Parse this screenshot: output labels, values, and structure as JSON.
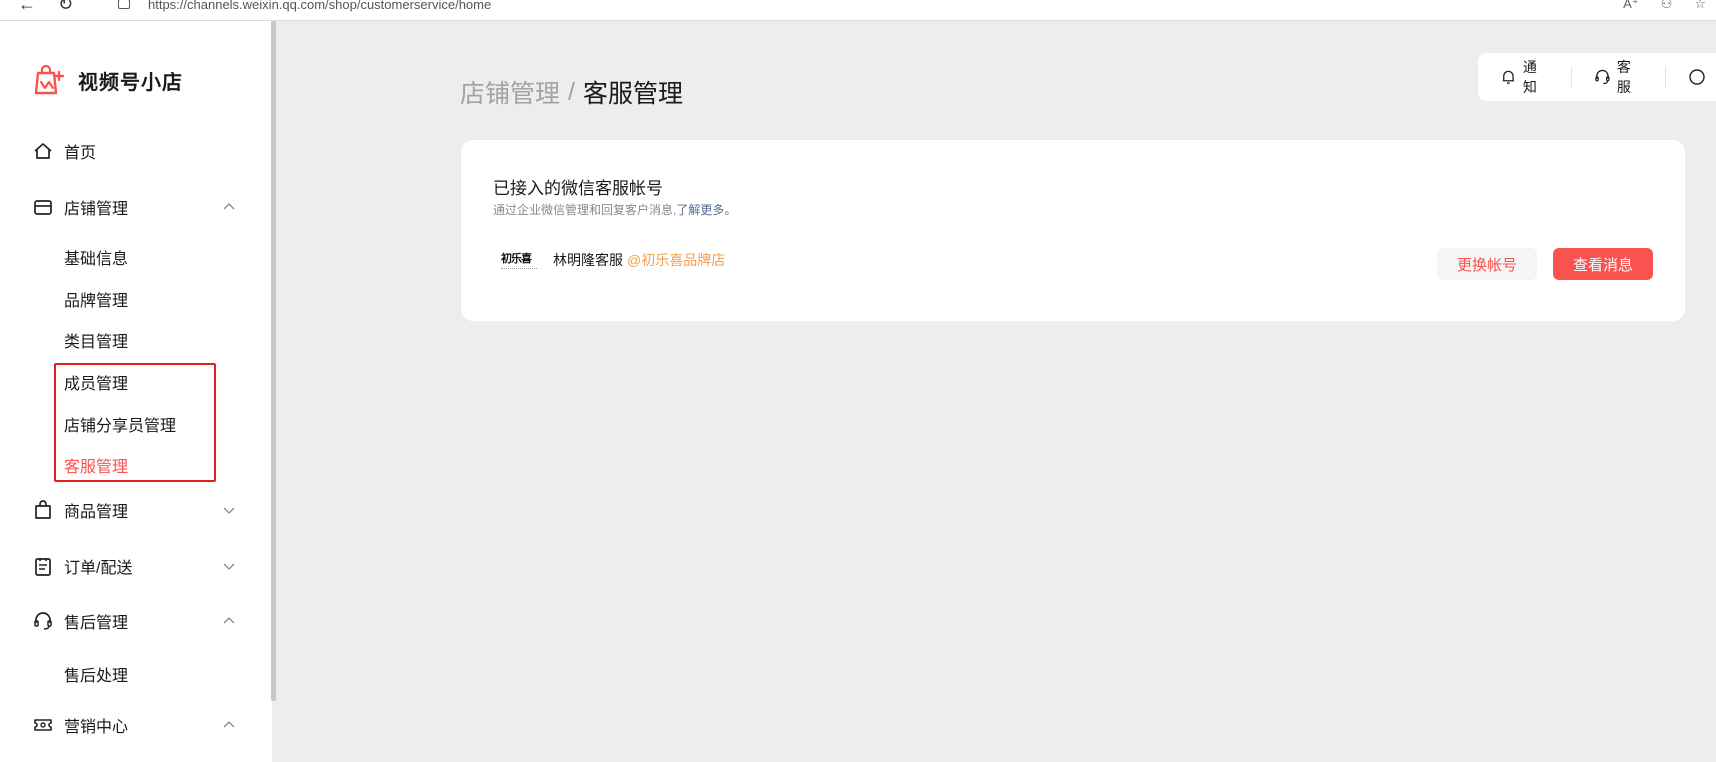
{
  "browser": {
    "url": "https://channels.weixin.qq.com/shop/customerservice/home",
    "back_icon": "arrow-left-icon",
    "reload_icon": "reload-icon"
  },
  "app": {
    "name": "视频号小店",
    "accent_color": "#fa5151"
  },
  "sidebar": {
    "home": "首页",
    "store": {
      "label": "店铺管理",
      "children": [
        "基础信息",
        "品牌管理",
        "类目管理",
        "成员管理",
        "店铺分享员管理",
        "客服管理"
      ]
    },
    "products": "商品管理",
    "orders": "订单/配送",
    "aftersales": {
      "label": "售后管理",
      "children": [
        "售后处理"
      ]
    },
    "marketing": "营销中心"
  },
  "top_actions": {
    "notify": "通知",
    "service": "客服"
  },
  "breadcrumb": {
    "parent": "店铺管理",
    "separator": "/",
    "current": "客服管理"
  },
  "card": {
    "title": "已接入的微信客服帐号",
    "description": "通过企业微信管理和回复客户消息,",
    "learn_more": "了解更多。",
    "account": {
      "logo_text": "初乐喜",
      "name": "林明隆客服",
      "shop": "@初乐喜品牌店"
    },
    "switch_button": "更换帐号",
    "view_button": "查看消息"
  }
}
